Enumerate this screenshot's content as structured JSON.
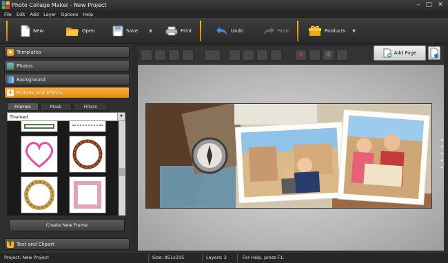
{
  "window": {
    "title": "Photo Collage Maker - New Project",
    "minimize": "–",
    "maximize": "□",
    "close": "✕"
  },
  "menu": [
    "File",
    "Edit",
    "Add",
    "Layer",
    "Options",
    "Help"
  ],
  "toolbar": {
    "new": "New",
    "open": "Open",
    "save": "Save",
    "print": "Print",
    "undo": "Undo",
    "redo": "Redo",
    "products": "Products"
  },
  "sidebar": {
    "sections": [
      "Templates",
      "Photos",
      "Background",
      "Frames and Effects"
    ],
    "bottom_section": "Text and Clipart",
    "tabs": [
      "Frames",
      "Mask",
      "Filters"
    ],
    "frame_category": "Themed",
    "create_frame": "Create New Frame"
  },
  "canvas": {
    "add_page": "Add Page"
  },
  "status": {
    "project": "Project: New Project",
    "size": "Size: 851x315",
    "layers": "Layers: 3",
    "help": "For Help, press F1."
  },
  "colors": {
    "accent": "#f0a020",
    "separator": "#f4c000",
    "panel": "#2f2f2f"
  }
}
